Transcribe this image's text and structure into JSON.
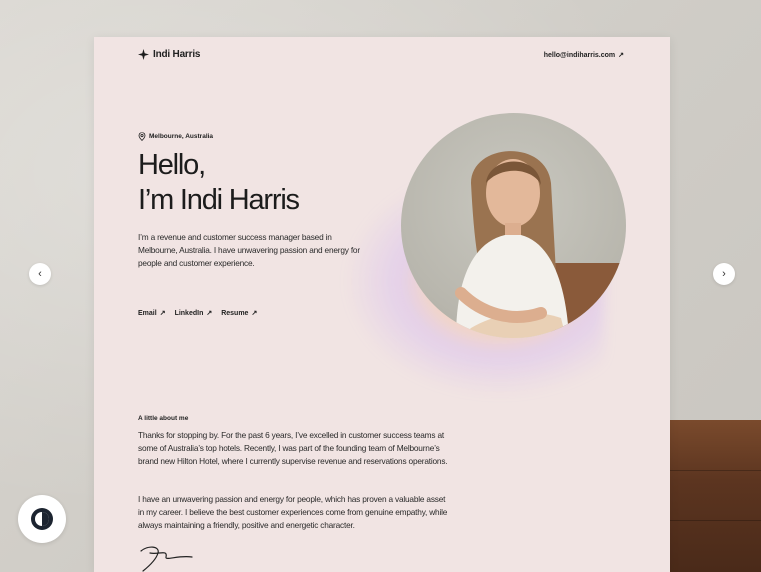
{
  "site": {
    "brand": "Indi Harris",
    "email": "hello@indiharris.com",
    "location": "Melbourne, Australia",
    "greeting_line1": "Hello,",
    "greeting_line2": "I’m Indi Harris",
    "intro": "I’m a revenue and customer success manager based in Melbourne, Australia. I have unwavering passion and energy for people and customer experience.",
    "links": [
      {
        "label": "Email"
      },
      {
        "label": "LinkedIn"
      },
      {
        "label": "Resume"
      }
    ],
    "about_heading": "A little about me",
    "about_paragraphs": [
      "Thanks for stopping by. For the past 6 years, I’ve excelled in customer success teams at some of Australia’s top hotels. Recently, I was part of the founding team of Melbourne’s brand new Hilton Hotel, where I currently supervise revenue and reservations operations.",
      "I have an unwavering passion and energy for people, which has proven a valuable asset in my career. I believe the best customer experiences come from genuine empathy, while always maintaining a friendly, positive and energetic character."
    ]
  },
  "icons": {
    "logo": "sparkle-icon",
    "external": "arrow-up-right-icon",
    "location": "map-pin-icon",
    "prev": "chevron-left-icon",
    "next": "chevron-right-icon",
    "theme": "contrast-icon"
  },
  "colors": {
    "page_background": "#f1e4e3",
    "text": "#1c1c1c",
    "glow_pink": "#ff8cbe",
    "glow_orange": "#ffbe78"
  }
}
